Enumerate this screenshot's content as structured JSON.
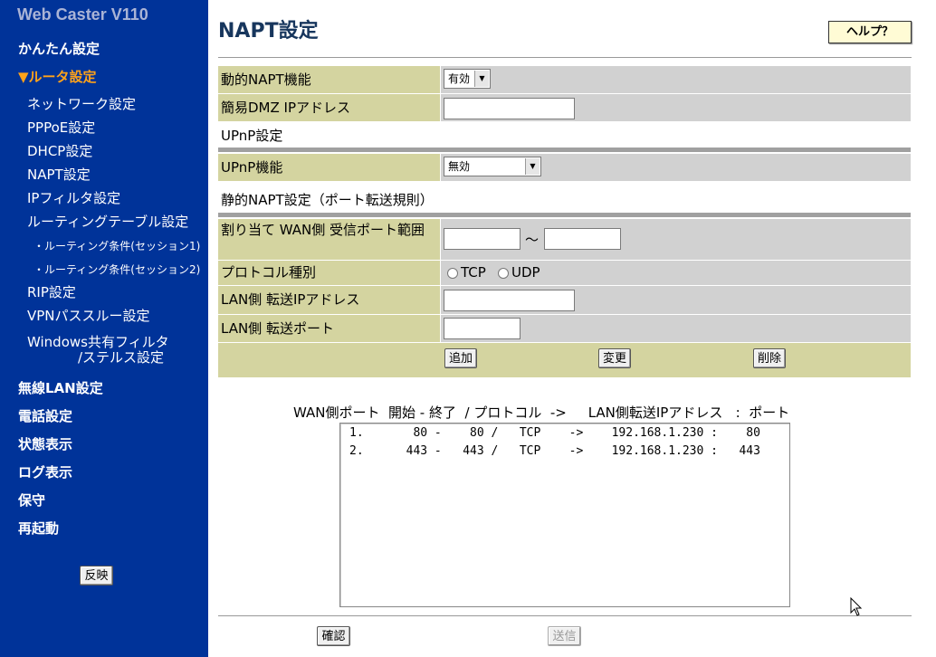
{
  "sidebar": {
    "product": "Web Caster V110",
    "apply_label": "反映",
    "top_items": [
      "かんたん設定"
    ],
    "current": "▼ルータ設定",
    "sub_items": [
      "ネットワーク設定",
      "PPPoE設定",
      "DHCP設定",
      "NAPT設定",
      "IPフィルタ設定",
      "ルーティングテーブル設定"
    ],
    "subsub_items": [
      "・ルーティング条件(セッション1)",
      "・ルーティング条件(セッション2)"
    ],
    "sub_items2": [
      "RIP設定",
      "VPNパススルー設定"
    ],
    "windows_filter": [
      "Windows共有フィルタ",
      "/ステルス設定"
    ],
    "bottom_items": [
      "無線LAN設定",
      "電話設定",
      "状態表示",
      "ログ表示",
      "保守",
      "再起動"
    ]
  },
  "main": {
    "title": "NAPT設定",
    "help_label": "ヘルプ？",
    "dynamic_napt": {
      "label": "動的NAPT機能",
      "value": "有効"
    },
    "dmz": {
      "label": "簡易DMZ IPアドレス",
      "value": ""
    },
    "upnp_section": "UPnP設定",
    "upnp": {
      "label": "UPnP機能",
      "value": "無効"
    },
    "static_section": "静的NAPT設定（ポート転送規則）",
    "wan_port": {
      "label": "割り当て WAN側 受信ポート範囲",
      "separator": "〜",
      "from": "",
      "to": ""
    },
    "protocol": {
      "label": "プロトコル種別",
      "options": [
        "TCP",
        "UDP"
      ]
    },
    "lan_ip": {
      "label": "LAN側 転送IPアドレス",
      "value": ""
    },
    "lan_port": {
      "label": "LAN側 転送ポート",
      "value": ""
    },
    "buttons": {
      "add": "追加",
      "change": "変更",
      "delete": "削除"
    },
    "list_header": "WAN側ポート  開始 - 終了  / プロトコル  ->     LAN側転送IPアドレス   :  ポート",
    "list_rows": [
      "1.       80 -    80 /   TCP    ->    192.168.1.230 :    80",
      "2.      443 -   443 /   TCP    ->    192.168.1.230 :   443"
    ],
    "confirm_label": "確認",
    "send_label": "送信"
  }
}
